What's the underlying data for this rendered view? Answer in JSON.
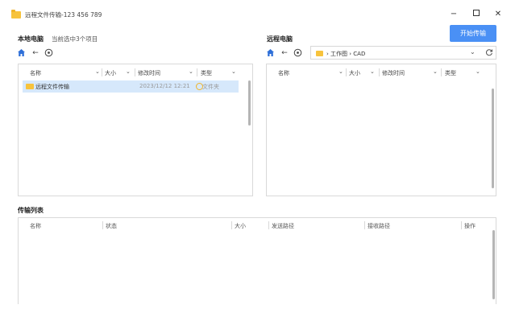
{
  "window": {
    "title": "远程文件传输-123 456 789",
    "minimize": "−",
    "close": "✕"
  },
  "toolbar": {
    "start_label": "开始传输"
  },
  "local": {
    "title": "本地电脑",
    "subtitle": "当前选中3个项目",
    "columns": [
      "名称",
      "大小",
      "修改时间",
      "类型"
    ],
    "rows": [
      {
        "name": "远程文件传输",
        "date": "2023/12/12 12:21",
        "type": "文件夹"
      }
    ]
  },
  "remote": {
    "title": "远程电脑",
    "path": "工作图 › CAD",
    "path_sep": "›",
    "columns": [
      "名称",
      "大小",
      "修改时间",
      "类型"
    ]
  },
  "transfer": {
    "title": "传输列表",
    "columns": [
      "名称",
      "状态",
      "大小",
      "发送路径",
      "接收路径",
      "操作"
    ]
  },
  "icons": {
    "home": "home-icon",
    "back": "arrow-left-icon",
    "add": "circle-add-icon",
    "refresh": "refresh-icon",
    "dropdown": "chevron-down-icon",
    "folder": "folder-icon"
  },
  "colors": {
    "accent": "#4a90f5",
    "home": "#2e6fd8",
    "folder": "#f7c33c",
    "selected_row": "#d6e8fb"
  }
}
